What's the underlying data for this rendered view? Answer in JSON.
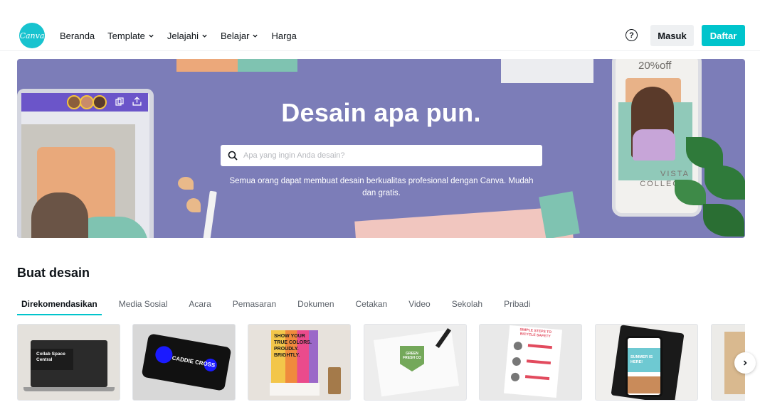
{
  "logo": {
    "text": "Canva"
  },
  "nav": {
    "items": [
      {
        "label": "Beranda",
        "dropdown": false
      },
      {
        "label": "Template",
        "dropdown": true
      },
      {
        "label": "Jelajahi",
        "dropdown": true
      },
      {
        "label": "Belajar",
        "dropdown": true
      },
      {
        "label": "Harga",
        "dropdown": false
      }
    ]
  },
  "header": {
    "help_icon": "?",
    "login_label": "Masuk",
    "signup_label": "Daftar"
  },
  "hero": {
    "title": "Desain apa pun.",
    "search_placeholder": "Apa yang ingin Anda desain?",
    "subtitle": "Semua orang dapat membuat desain berkualitas profesional dengan Canva. Mudah dan gratis.",
    "phone_promo": "20%off",
    "phone_caption_line1": "VISTA",
    "phone_caption_line2": "COLLECTI"
  },
  "create": {
    "title": "Buat desain",
    "tabs": [
      {
        "label": "Direkomendasikan",
        "active": true
      },
      {
        "label": "Media Sosial",
        "active": false
      },
      {
        "label": "Acara",
        "active": false
      },
      {
        "label": "Pemasaran",
        "active": false
      },
      {
        "label": "Dokumen",
        "active": false
      },
      {
        "label": "Cetakan",
        "active": false
      },
      {
        "label": "Video",
        "active": false
      },
      {
        "label": "Sekolah",
        "active": false
      },
      {
        "label": "Pribadi",
        "active": false
      }
    ],
    "thumbnails": [
      {
        "text": "Collab Space Central"
      },
      {
        "text": "CADDIE CROSS"
      },
      {
        "text": "SHOW YOUR TRUE COLORS. PROUDLY. BRIGHTLY."
      },
      {
        "text": "GREEN FRESH CO"
      },
      {
        "text": "SIMPLE STEPS TO BICYCLE SAFETY"
      },
      {
        "text": "SUMMER IS HERE!"
      },
      {
        "text": ""
      }
    ]
  },
  "colors": {
    "accent": "#00c4cc",
    "hero_bg": "#7c7db8"
  }
}
